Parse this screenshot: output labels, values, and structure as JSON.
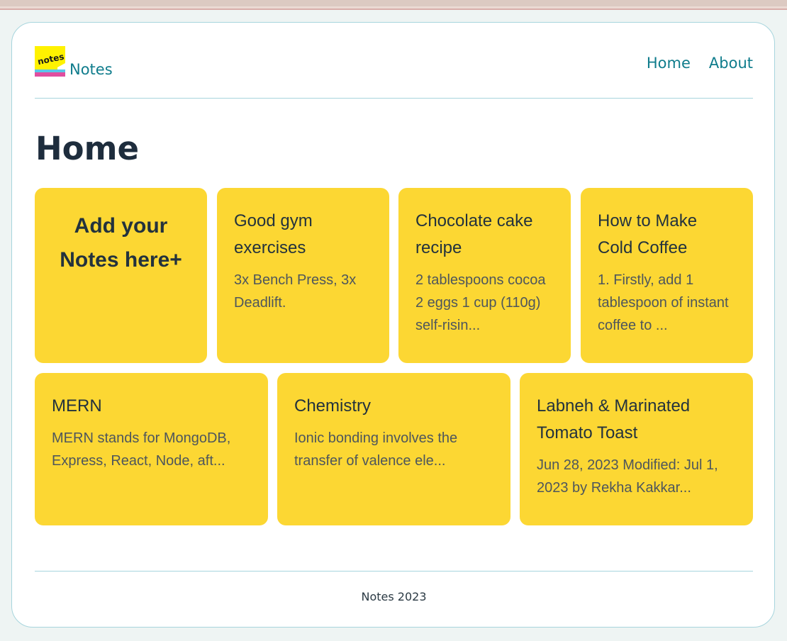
{
  "brand": {
    "logo_text": "notes",
    "name": "Notes"
  },
  "nav": {
    "items": [
      {
        "label": "Home"
      },
      {
        "label": "About"
      }
    ]
  },
  "page": {
    "title": "Home"
  },
  "add_note": {
    "label_line1": "Add your",
    "label_line2": "Notes here+"
  },
  "notes": [
    {
      "title": "Good gym exercises",
      "body": "3x Bench Press, 3x Deadlift."
    },
    {
      "title": "Chocolate cake recipe",
      "body": "2 tablespoons cocoa 2 eggs 1 cup (110g) self-risin..."
    },
    {
      "title": "How to Make Cold Coffee",
      "body": "1. Firstly, add 1 tablespoon of instant coffee to ..."
    },
    {
      "title": "MERN",
      "body": "MERN stands for MongoDB, Express, React, Node, aft..."
    },
    {
      "title": "Chemistry",
      "body": "Ionic bonding involves the transfer of valence ele..."
    },
    {
      "title": "Labneh & Marinated Tomato Toast",
      "body": "Jun 28, 2023 Modified: Jul 1, 2023 by Rekha Kakkar..."
    }
  ],
  "footer": {
    "text": "Notes 2023"
  },
  "colors": {
    "accent": "#0f7c8c",
    "note_bg": "#fcd733",
    "heading": "#1e2d3d",
    "border": "#a7d5dd"
  }
}
